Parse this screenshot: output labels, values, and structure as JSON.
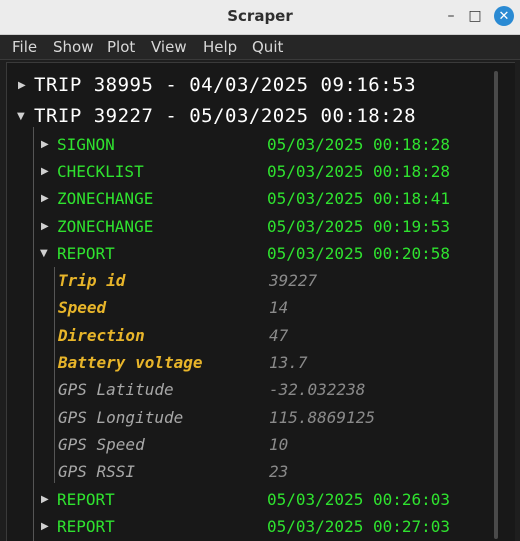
{
  "window": {
    "title": "Scraper"
  },
  "menu": [
    "File",
    "Show",
    "Plot",
    "View",
    "Help",
    "Quit"
  ],
  "trips": [
    {
      "label": "TRIP 38995 - 04/03/2025 09:16:53",
      "expanded": false
    },
    {
      "label": "TRIP 39227 - 05/03/2025 00:18:28",
      "expanded": true
    }
  ],
  "events": [
    {
      "name": "SIGNON",
      "time": "05/03/2025 00:18:28",
      "expanded": false
    },
    {
      "name": "CHECKLIST",
      "time": "05/03/2025 00:18:28",
      "expanded": false
    },
    {
      "name": "ZONECHANGE",
      "time": "05/03/2025 00:18:41",
      "expanded": false
    },
    {
      "name": "ZONECHANGE",
      "time": "05/03/2025 00:19:53",
      "expanded": false
    },
    {
      "name": "REPORT",
      "time": "05/03/2025 00:20:58",
      "expanded": true
    },
    {
      "name": "REPORT",
      "time": "05/03/2025 00:26:03",
      "expanded": false
    },
    {
      "name": "REPORT",
      "time": "05/03/2025 00:27:03",
      "expanded": false
    }
  ],
  "report_fields": [
    {
      "name": "Trip id",
      "value": "39227",
      "highlight": true
    },
    {
      "name": "Speed",
      "value": "14",
      "highlight": true
    },
    {
      "name": "Direction",
      "value": "47",
      "highlight": true
    },
    {
      "name": "Battery voltage",
      "value": "13.7",
      "highlight": true
    },
    {
      "name": "GPS Latitude",
      "value": "-32.032238",
      "highlight": false
    },
    {
      "name": "GPS Longitude",
      "value": "115.8869125",
      "highlight": false
    },
    {
      "name": "GPS Speed",
      "value": "10",
      "highlight": false
    },
    {
      "name": "GPS RSSI",
      "value": "23",
      "highlight": false
    }
  ],
  "icons": {
    "collapsed": "triangle-right-icon",
    "expanded": "triangle-down-icon"
  },
  "colors": {
    "event": "#2fe22f",
    "highlight_field": "#e8b52a",
    "field": "#a7a7a7",
    "value": "#8a8a8a"
  }
}
